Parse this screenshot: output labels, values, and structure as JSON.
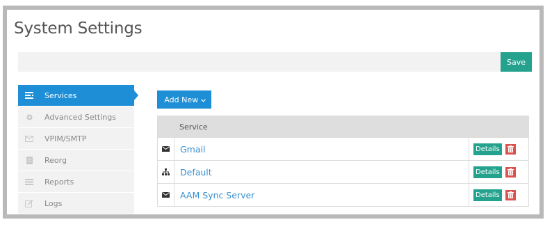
{
  "page": {
    "title": "System Settings"
  },
  "toolbar": {
    "save_label": "Save"
  },
  "sidebar": {
    "items": [
      {
        "label": "Services",
        "icon": "list-icon",
        "active": true
      },
      {
        "label": "Advanced Settings",
        "icon": "gear-icon",
        "active": false
      },
      {
        "label": "VPIM/SMTP",
        "icon": "envelope-icon",
        "active": false
      },
      {
        "label": "Reorg",
        "icon": "database-icon",
        "active": false
      },
      {
        "label": "Reports",
        "icon": "list-icon",
        "active": false
      },
      {
        "label": "Logs",
        "icon": "edit-icon",
        "active": false
      }
    ]
  },
  "main": {
    "add_new_label": "Add New",
    "table": {
      "header": "Service",
      "rows": [
        {
          "icon": "envelope-icon",
          "name": "Gmail",
          "details_label": "Details"
        },
        {
          "icon": "sitemap-icon",
          "name": "Default",
          "details_label": "Details"
        },
        {
          "icon": "envelope-icon",
          "name": "AAM Sync Server",
          "details_label": "Details"
        }
      ]
    }
  },
  "colors": {
    "primary": "#1e8fd6",
    "success": "#25a28e",
    "danger": "#d9534f",
    "link": "#3a8fcf"
  }
}
